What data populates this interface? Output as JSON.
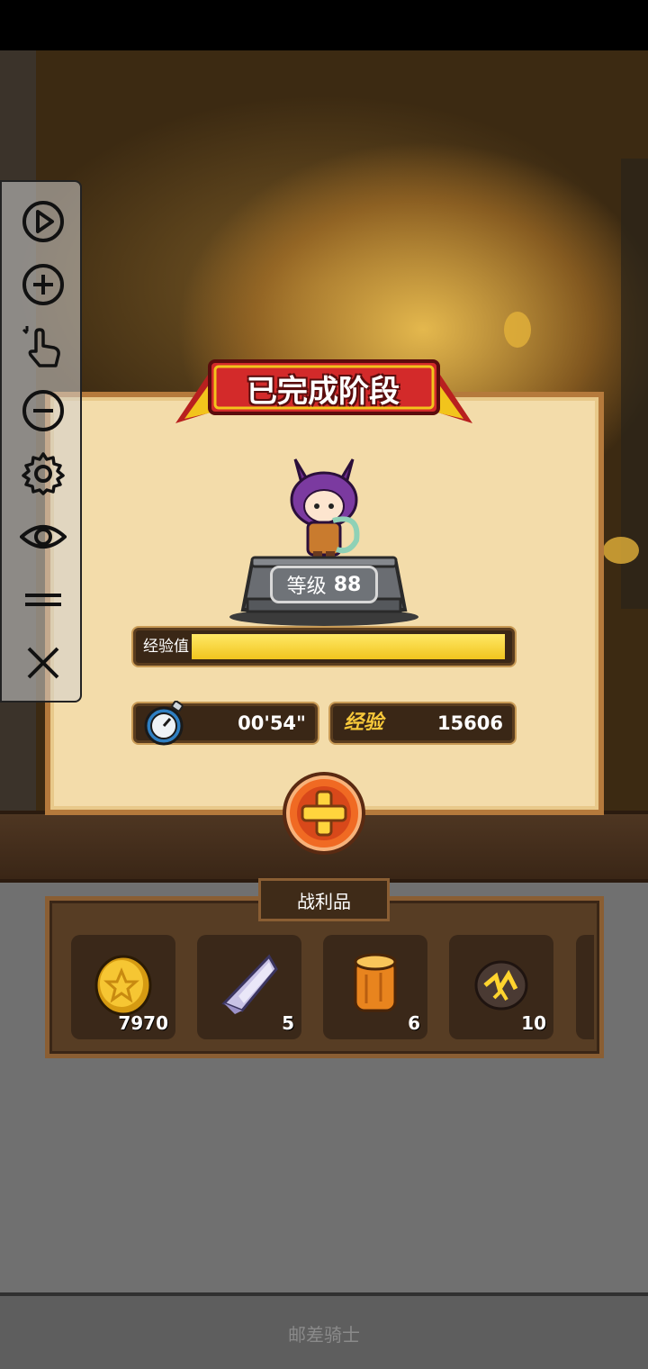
{
  "stage": {
    "title": "已完成阶段",
    "level_label": "等级",
    "level_value": "88",
    "xp_bar_label": "经验值",
    "xp_progress": 0.99,
    "time_value": "00'54\"",
    "xp_reward_label": "经验",
    "xp_reward_value": "15606"
  },
  "loot": {
    "title": "战利品",
    "items": [
      {
        "icon": "gold-coin-icon",
        "count": "7970"
      },
      {
        "icon": "crystal-icon",
        "count": "5"
      },
      {
        "icon": "wood-log-icon",
        "count": "6"
      },
      {
        "icon": "ore-rock-icon",
        "count": "10"
      }
    ]
  },
  "toolbar": {
    "icons": [
      "play-icon",
      "zoom-in-icon",
      "touch-icon",
      "zoom-out-icon",
      "gear-icon",
      "eye-icon",
      "menu-icon",
      "close-icon"
    ]
  },
  "footer": {
    "caption": "邮差骑士"
  },
  "colors": {
    "banner_red": "#c8262a",
    "xp_yellow": "#f1c51e",
    "add_orange": "#e8571c",
    "panel_bg": "#f3dcaa"
  }
}
